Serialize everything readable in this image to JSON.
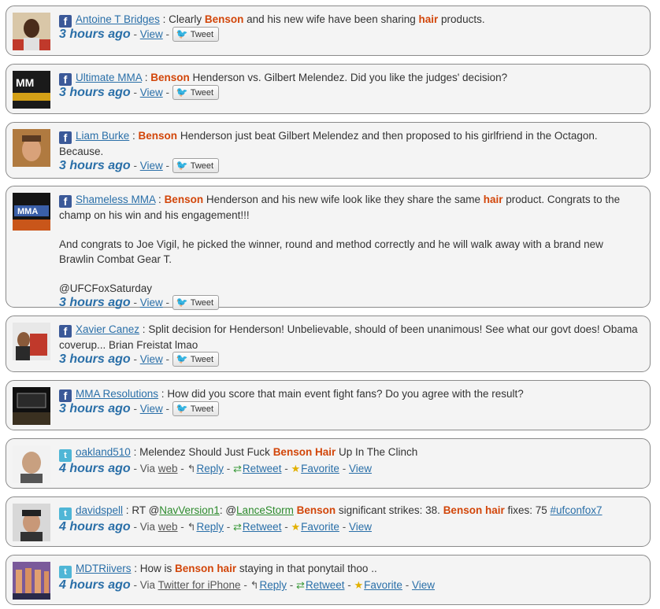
{
  "posts": [
    {
      "source": "facebook",
      "author": "Antoine T Bridges",
      "segments": [
        {
          "t": "Clearly "
        },
        {
          "t": "Benson",
          "k": 1
        },
        {
          "t": " and his new wife have been sharing "
        },
        {
          "t": "hair",
          "k": 1
        },
        {
          "t": " products."
        }
      ],
      "time": "3 hours ago",
      "view_label": "View",
      "tweet_label": "Tweet"
    },
    {
      "source": "facebook",
      "author": "Ultimate MMA",
      "segments": [
        {
          "t": "Benson",
          "k": 1
        },
        {
          "t": " Henderson vs. Gilbert Melendez. Did you like the judges' decision?"
        }
      ],
      "time": "3 hours ago",
      "view_label": "View",
      "tweet_label": "Tweet"
    },
    {
      "source": "facebook",
      "author": "Liam Burke",
      "segments": [
        {
          "t": "Benson",
          "k": 1
        },
        {
          "t": " Henderson just beat Gilbert Melendez and then proposed to his girlfriend in the Octagon. Because."
        }
      ],
      "time": "3 hours ago",
      "view_label": "View",
      "tweet_label": "Tweet"
    },
    {
      "source": "facebook",
      "author": "Shameless MMA",
      "segments": [
        {
          "t": "Benson",
          "k": 1
        },
        {
          "t": " Henderson and his new wife look like they share the same "
        },
        {
          "t": "hair",
          "k": 1
        },
        {
          "t": " product. Congrats to the champ on his win and his engagement!!!"
        }
      ],
      "extra_paragraphs": [
        "And congrats to Joe Vigil, he picked the winner, round and method correctly and he will walk away with a brand new Brawlin Combat Gear T.",
        "@UFCFoxSaturday"
      ],
      "time": "3 hours ago",
      "view_label": "View",
      "tweet_label": "Tweet"
    },
    {
      "source": "facebook",
      "author": "Xavier Canez",
      "segments": [
        {
          "t": "Split decision for Henderson! Unbelievable, should of been unanimous! See what our govt does! Obama coverup... Brian Freistat lmao"
        }
      ],
      "time": "3 hours ago",
      "view_label": "View",
      "tweet_label": "Tweet"
    },
    {
      "source": "facebook",
      "author": "MMA Resolutions",
      "segments": [
        {
          "t": "How did you score that main event fight fans? Do you agree with the result?"
        }
      ],
      "time": "3 hours ago",
      "view_label": "View",
      "tweet_label": "Tweet"
    },
    {
      "source": "twitter",
      "author": "oakland510",
      "segments": [
        {
          "t": "Melendez Should Just Fuck "
        },
        {
          "t": "Benson Hair",
          "k": 1
        },
        {
          "t": " Up In The Clinch"
        }
      ],
      "time": "4 hours ago",
      "via_label": "Via",
      "via_app": "web",
      "reply_label": "Reply",
      "retweet_label": "Retweet",
      "favorite_label": "Favorite",
      "view_label": "View"
    },
    {
      "source": "twitter",
      "author": "davidspell",
      "segments": [
        {
          "t": "RT @"
        },
        {
          "t": "NavVersion1",
          "g": 1
        },
        {
          "t": ": @"
        },
        {
          "t": "LanceStorm",
          "g": 1
        },
        {
          "t": " "
        },
        {
          "t": "Benson",
          "k": 1
        },
        {
          "t": " significant strikes: 38. "
        },
        {
          "t": "Benson hair",
          "k": 1
        },
        {
          "t": " fixes: 75 "
        },
        {
          "t": "#ufconfox7",
          "l": 1
        }
      ],
      "time": "4 hours ago",
      "via_label": "Via",
      "via_app": "web",
      "reply_label": "Reply",
      "retweet_label": "Retweet",
      "favorite_label": "Favorite",
      "view_label": "View"
    },
    {
      "source": "twitter",
      "author": "MDTRiivers",
      "segments": [
        {
          "t": "How is "
        },
        {
          "t": "Benson",
          "k": 1
        },
        {
          "t": " "
        },
        {
          "t": "hair",
          "k": 1
        },
        {
          "t": " staying in that ponytail thoo .."
        }
      ],
      "time": "4 hours ago",
      "via_label": "Via",
      "via_app": "Twitter for iPhone",
      "reply_label": "Reply",
      "retweet_label": "Retweet",
      "favorite_label": "Favorite",
      "view_label": "View"
    }
  ],
  "colors": {
    "keyword": "#d2460a",
    "link": "#2a6fa8",
    "mention": "#2e8b2e",
    "facebook": "#3b5998",
    "twitter": "#4fb6d6"
  },
  "icons": {
    "facebook_badge": "facebook-icon",
    "twitter_badge": "twitter-icon",
    "tweet_bird": "bird-icon",
    "reply": "reply-arrow-icon",
    "retweet": "retweet-icon",
    "favorite": "star-icon"
  }
}
